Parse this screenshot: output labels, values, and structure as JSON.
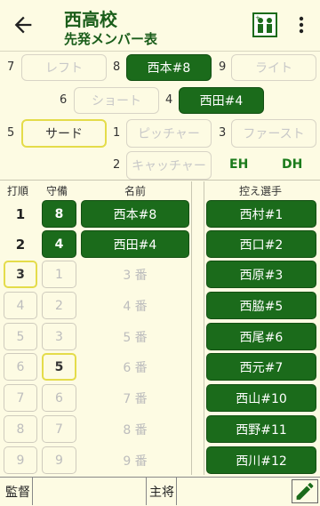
{
  "header": {
    "title": "西高校",
    "subtitle": "先発メンバー表"
  },
  "icons": {
    "back": "arrow-left-icon",
    "team": "team-icon",
    "more": "more-vert-icon",
    "edit": "pencil-icon"
  },
  "colors": {
    "accent_green": "#1b6b1b",
    "title_green": "#1a5d1a",
    "highlight": "#e4dc4a",
    "background": "#fdfbe3"
  },
  "positions": {
    "n7": "7",
    "left_field": "レフト",
    "n8": "8",
    "center_field": "西本#8",
    "n9": "9",
    "right_field": "ライト",
    "n6": "6",
    "shortstop": "ショート",
    "n4": "4",
    "second_base": "西田#4",
    "n5": "5",
    "third_base": "サード",
    "n1": "1",
    "pitcher": "ピッチャー",
    "n3": "3",
    "first_base": "ファースト",
    "n2": "2",
    "catcher": "キャッチャー",
    "eh": "EH",
    "dh": "DH"
  },
  "lineup_headers": {
    "order": "打順",
    "defense": "守備",
    "name": "名前",
    "bench": "控え選手"
  },
  "lineup": [
    {
      "order": "1",
      "defense": "8",
      "name": "西本#8"
    },
    {
      "order": "2",
      "defense": "4",
      "name": "西田#4"
    },
    {
      "order": "3",
      "defense": "1",
      "name": "3 番"
    },
    {
      "order": "4",
      "defense": "2",
      "name": "4 番"
    },
    {
      "order": "5",
      "defense": "3",
      "name": "5 番"
    },
    {
      "order": "6",
      "defense": "5",
      "name": "6 番"
    },
    {
      "order": "7",
      "defense": "6",
      "name": "7 番"
    },
    {
      "order": "8",
      "defense": "7",
      "name": "8 番"
    },
    {
      "order": "9",
      "defense": "9",
      "name": "9 番"
    }
  ],
  "bench": [
    "西村#1",
    "西口#2",
    "西原#3",
    "西脇#5",
    "西尾#6",
    "西元#7",
    "西山#10",
    "西野#11",
    "西川#12"
  ],
  "footer": {
    "manager_label": "監督",
    "captain_label": "主将"
  }
}
